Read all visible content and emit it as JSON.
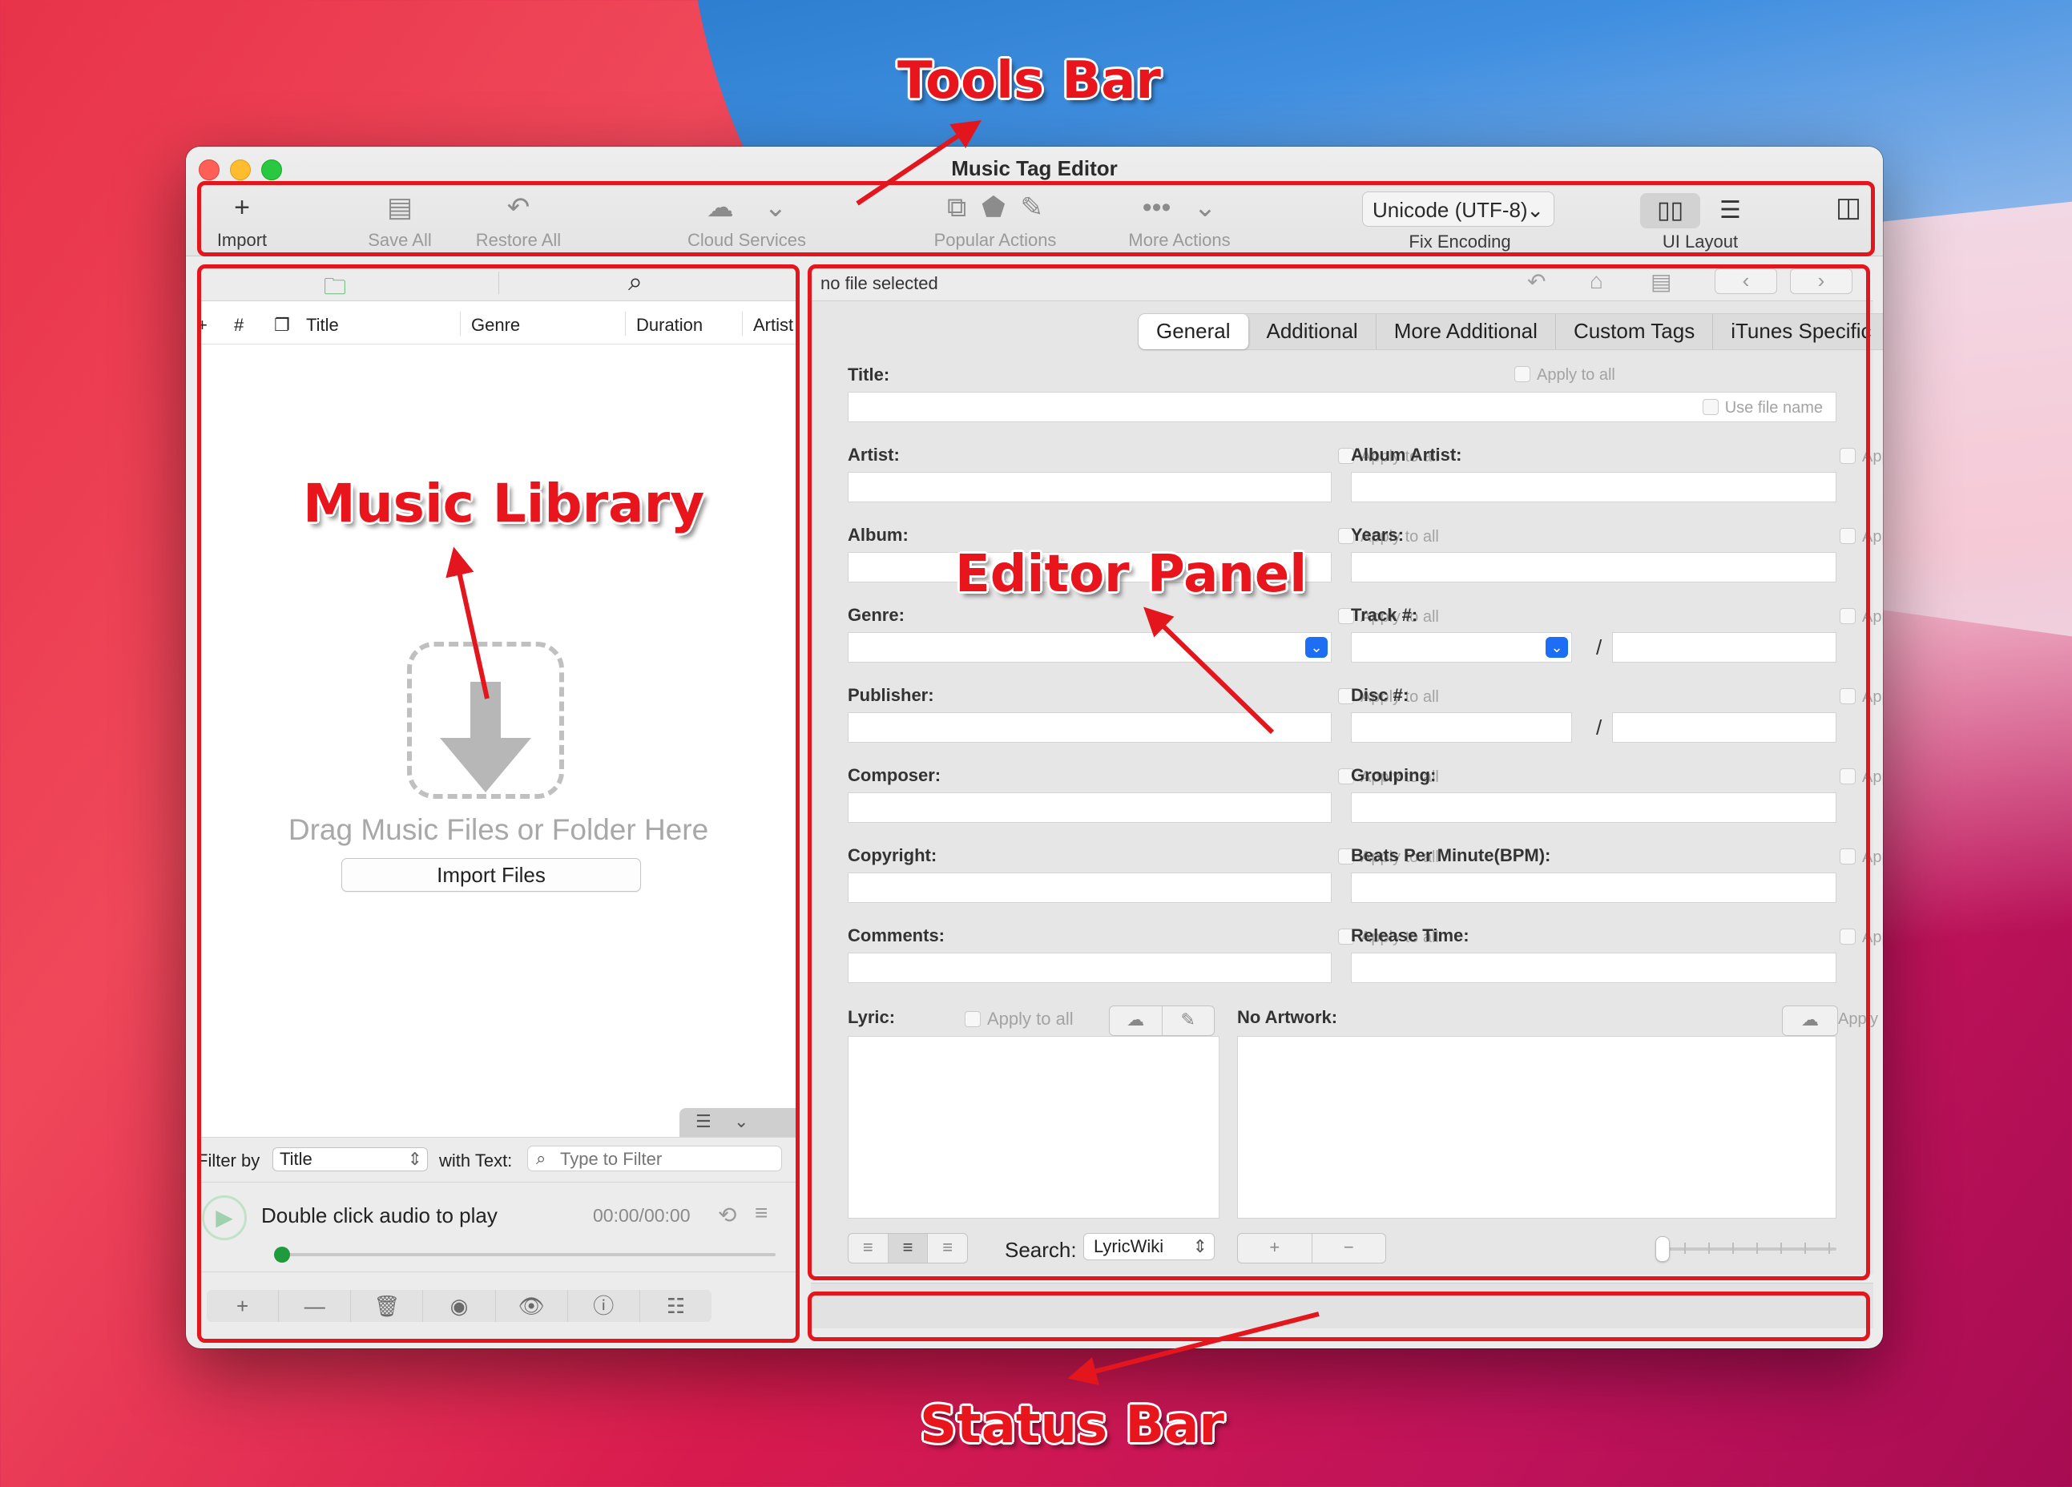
{
  "window": {
    "title": "Music Tag Editor"
  },
  "toolbar": {
    "import": {
      "icon": "plus-icon",
      "label": "Import"
    },
    "save_all": {
      "icon": "save-icon",
      "label": "Save All"
    },
    "restore_all": {
      "icon": "undo-icon",
      "label": "Restore All"
    },
    "cloud_services": {
      "icon": "cloud-icon",
      "label": "Cloud Services"
    },
    "popular_actions": {
      "icon": "tag-icon",
      "label": "Popular Actions"
    },
    "more_actions": {
      "icon": "ellipsis-icon",
      "label": "More Actions"
    },
    "encoding": {
      "value": "Unicode (UTF-8)",
      "label": "Fix Encoding"
    },
    "ui_layout": {
      "label": "UI Layout"
    }
  },
  "library": {
    "columns": [
      "+",
      "#",
      "❐",
      "Title",
      "Genre",
      "Duration",
      "Artist"
    ],
    "drop_text": "Drag Music Files or Folder Here",
    "import_button": "Import Files",
    "filter": {
      "label": "Filter by",
      "value": "Title",
      "text_label": "with Text:",
      "placeholder": "Type to Filter"
    },
    "player": {
      "message": "Double click audio to play",
      "time": "00:00/00:00",
      "progress": 0
    },
    "bottom_buttons": [
      "+",
      "—",
      "🗑",
      "◉",
      "👁",
      "ⓘ",
      "☷"
    ]
  },
  "editor": {
    "file_status": "no file selected",
    "tabs": [
      "General",
      "Additional",
      "More Additional",
      "Custom Tags",
      "iTunes Specific"
    ],
    "active_tab": "General",
    "apply_label": "Apply to all",
    "use_file_name": "Use file name",
    "fields": {
      "title": "Title:",
      "artist": "Artist:",
      "album_artist": "Album Artist:",
      "album": "Album:",
      "years": "Years:",
      "genre": "Genre:",
      "track": "Track #:",
      "publisher": "Publisher:",
      "disc": "Disc #:",
      "composer": "Composer:",
      "grouping": "Grouping:",
      "copyright": "Copyright:",
      "bpm": "Beats Per Minute(BPM):",
      "comments": "Comments:",
      "release_time": "Release Time:",
      "lyric": "Lyric:",
      "artwork": "No Artwork:"
    },
    "slash": "/",
    "search_label": "Search:",
    "search_source": "LyricWiki"
  },
  "annotations": {
    "tools_bar": "Tools Bar",
    "music_library": "Music Library",
    "editor_panel": "Editor Panel",
    "status_bar": "Status Bar",
    "color": "#e4161d"
  }
}
